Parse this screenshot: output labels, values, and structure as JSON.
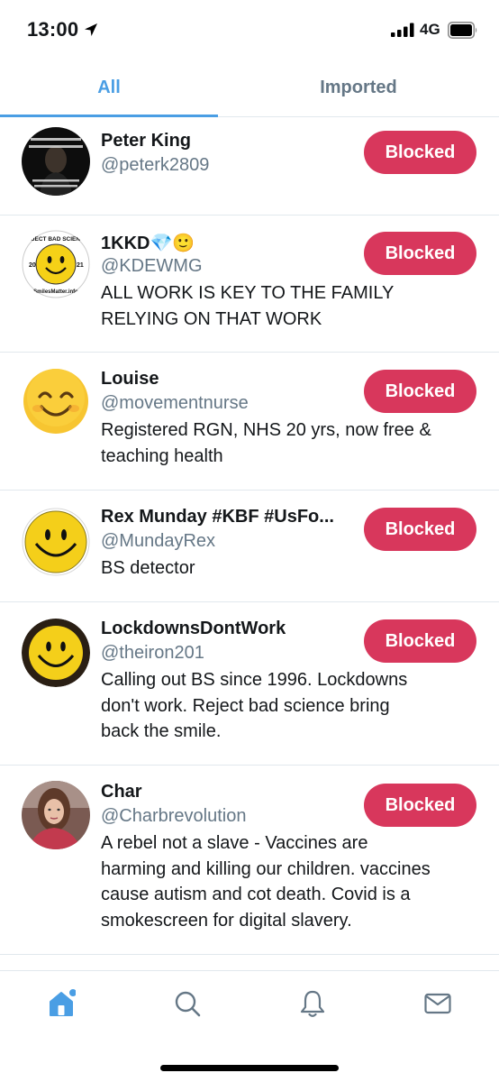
{
  "status_bar": {
    "time": "13:00",
    "network": "4G"
  },
  "tabs": [
    {
      "label": "All",
      "active": true
    },
    {
      "label": "Imported",
      "active": false
    }
  ],
  "accounts": [
    {
      "name": "Peter King",
      "handle": "@peterk2809",
      "bio": [],
      "button": "Blocked",
      "avatar": "dark-portrait-avatar"
    },
    {
      "name": "1KKD💎🙂",
      "handle": "@KDEWMG",
      "bio": [
        "ALL WORK IS KEY TO THE FAMILY",
        "RELYING ON THAT WORK"
      ],
      "button": "Blocked",
      "avatar": "smiley-badge-avatar",
      "avatar_text": [
        "REJECT BAD SCIENCE",
        "20",
        "21",
        "SmilesMatter.info"
      ]
    },
    {
      "name": "Louise",
      "handle": "@movementnurse",
      "bio": [
        "Registered RGN, NHS 20 yrs, now free &",
        "teaching health"
      ],
      "button": "Blocked",
      "avatar": "smiling-emoji-avatar"
    },
    {
      "name": "Rex Munday #KBF #UsFo...",
      "handle": "@MundayRex",
      "bio": [
        "BS detector"
      ],
      "button": "Blocked",
      "avatar": "yellow-smiley-avatar"
    },
    {
      "name": "LockdownsDontWork",
      "handle": "@theiron201",
      "bio": [
        "Calling out BS since 1996. Lockdowns",
        "don't work. Reject bad science bring",
        "back the smile."
      ],
      "button": "Blocked",
      "avatar": "dark-ring-smiley-avatar"
    },
    {
      "name": "Char",
      "handle": "@Charbrevolution",
      "bio": [
        "A rebel not a slave - Vaccines are",
        "harming and killing our children. vaccines",
        "cause autism and cot death. Covid is a",
        "smokescreen for digital slavery."
      ],
      "button": "Blocked",
      "avatar": "photo-portrait-avatar"
    }
  ],
  "bottom_nav": [
    "home-icon",
    "search-icon",
    "bell-icon",
    "mail-icon"
  ],
  "colors": {
    "accent": "#4a9ee4",
    "blocked": "#d8375c",
    "secondary_text": "#657786",
    "divider": "#e1e8ed"
  }
}
